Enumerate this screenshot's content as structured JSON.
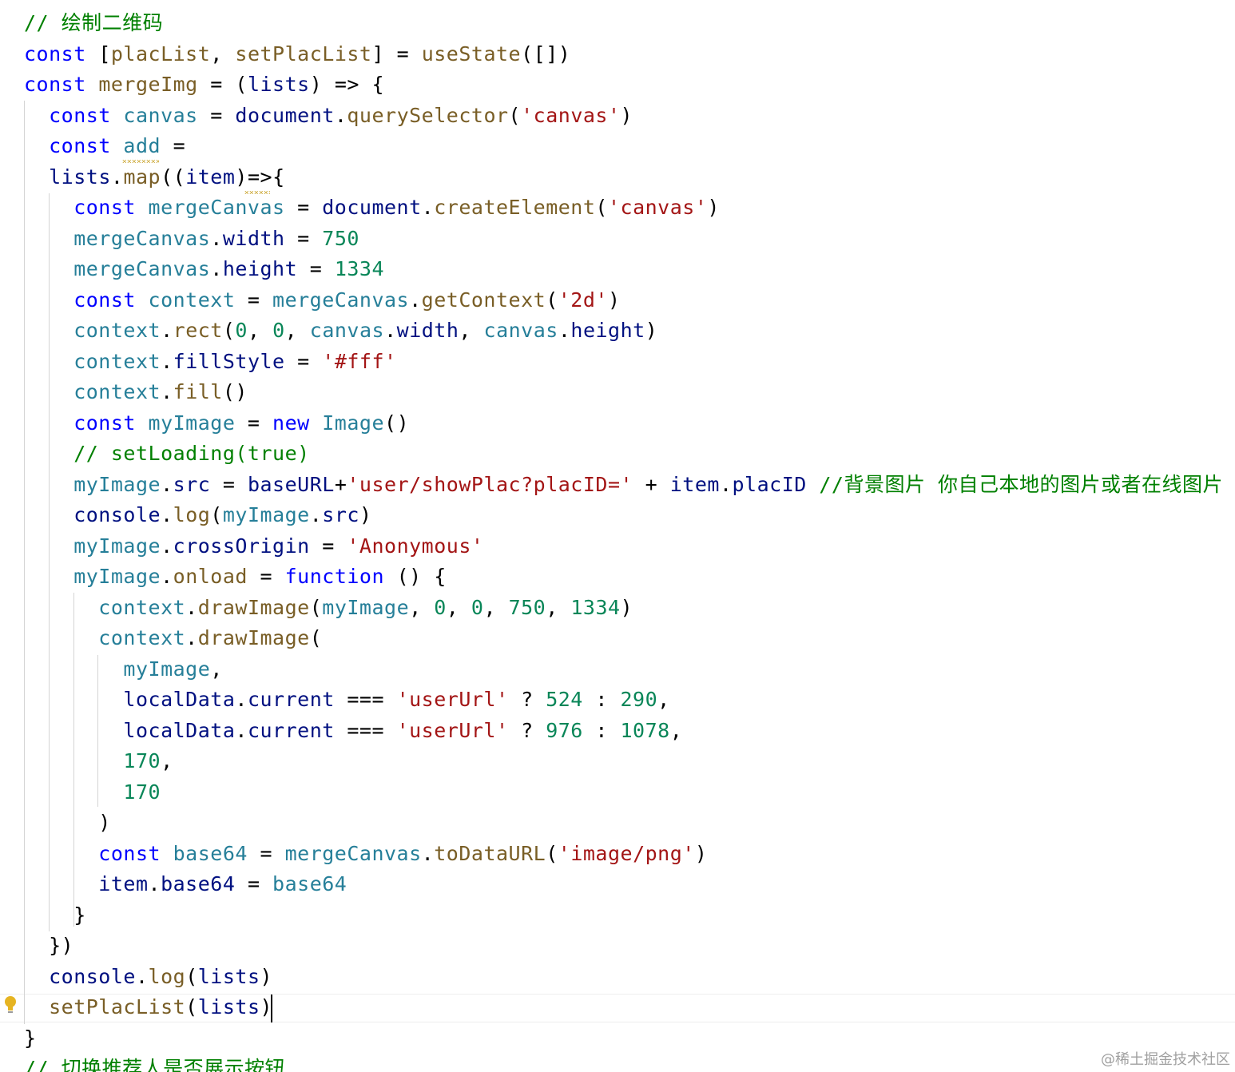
{
  "editor": {
    "colors": {
      "keyword": "#0000ff",
      "variable": "#267f99",
      "function": "#795e26",
      "string": "#a31515",
      "number": "#098658",
      "comment": "#008000",
      "plain": "#001080",
      "text": "#000000"
    },
    "lines": [
      [
        {
          "t": "// 绘制二维码",
          "c": "comment"
        }
      ],
      [
        {
          "t": "const ",
          "c": "keyword"
        },
        {
          "t": "[",
          "c": "text"
        },
        {
          "t": "placList",
          "c": "function"
        },
        {
          "t": ", ",
          "c": "text"
        },
        {
          "t": "setPlacList",
          "c": "function"
        },
        {
          "t": "] = ",
          "c": "text"
        },
        {
          "t": "useState",
          "c": "function"
        },
        {
          "t": "([])",
          "c": "text"
        }
      ],
      [
        {
          "t": "const ",
          "c": "keyword"
        },
        {
          "t": "mergeImg",
          "c": "function"
        },
        {
          "t": " = (",
          "c": "text"
        },
        {
          "t": "lists",
          "c": "plain"
        },
        {
          "t": ") => {",
          "c": "text"
        }
      ],
      [
        {
          "t": "  const ",
          "c": "keyword"
        },
        {
          "t": "canvas",
          "c": "variable"
        },
        {
          "t": " = ",
          "c": "text"
        },
        {
          "t": "document",
          "c": "plain"
        },
        {
          "t": ".",
          "c": "text"
        },
        {
          "t": "querySelector",
          "c": "function"
        },
        {
          "t": "(",
          "c": "text"
        },
        {
          "t": "'canvas'",
          "c": "string"
        },
        {
          "t": ")",
          "c": "text"
        }
      ],
      [
        {
          "t": "  const ",
          "c": "keyword"
        },
        {
          "t": "add",
          "c": "variable"
        },
        {
          "t": " =",
          "c": "text"
        }
      ],
      [
        {
          "t": "  ",
          "c": "text"
        },
        {
          "t": "lists",
          "c": "plain"
        },
        {
          "t": ".",
          "c": "text"
        },
        {
          "t": "map",
          "c": "function"
        },
        {
          "t": "((",
          "c": "text"
        },
        {
          "t": "item",
          "c": "plain"
        },
        {
          "t": ")=>{",
          "c": "text"
        }
      ],
      [
        {
          "t": "    const ",
          "c": "keyword"
        },
        {
          "t": "mergeCanvas",
          "c": "variable"
        },
        {
          "t": " = ",
          "c": "text"
        },
        {
          "t": "document",
          "c": "plain"
        },
        {
          "t": ".",
          "c": "text"
        },
        {
          "t": "createElement",
          "c": "function"
        },
        {
          "t": "(",
          "c": "text"
        },
        {
          "t": "'canvas'",
          "c": "string"
        },
        {
          "t": ")",
          "c": "text"
        }
      ],
      [
        {
          "t": "    mergeCanvas",
          "c": "variable"
        },
        {
          "t": ".",
          "c": "text"
        },
        {
          "t": "width",
          "c": "plain"
        },
        {
          "t": " = ",
          "c": "text"
        },
        {
          "t": "750",
          "c": "number"
        }
      ],
      [
        {
          "t": "    mergeCanvas",
          "c": "variable"
        },
        {
          "t": ".",
          "c": "text"
        },
        {
          "t": "height",
          "c": "plain"
        },
        {
          "t": " = ",
          "c": "text"
        },
        {
          "t": "1334",
          "c": "number"
        }
      ],
      [
        {
          "t": "    const ",
          "c": "keyword"
        },
        {
          "t": "context",
          "c": "variable"
        },
        {
          "t": " = ",
          "c": "text"
        },
        {
          "t": "mergeCanvas",
          "c": "variable"
        },
        {
          "t": ".",
          "c": "text"
        },
        {
          "t": "getContext",
          "c": "function"
        },
        {
          "t": "(",
          "c": "text"
        },
        {
          "t": "'2d'",
          "c": "string"
        },
        {
          "t": ")",
          "c": "text"
        }
      ],
      [
        {
          "t": "    context",
          "c": "variable"
        },
        {
          "t": ".",
          "c": "text"
        },
        {
          "t": "rect",
          "c": "function"
        },
        {
          "t": "(",
          "c": "text"
        },
        {
          "t": "0",
          "c": "number"
        },
        {
          "t": ", ",
          "c": "text"
        },
        {
          "t": "0",
          "c": "number"
        },
        {
          "t": ", ",
          "c": "text"
        },
        {
          "t": "canvas",
          "c": "variable"
        },
        {
          "t": ".",
          "c": "text"
        },
        {
          "t": "width",
          "c": "plain"
        },
        {
          "t": ", ",
          "c": "text"
        },
        {
          "t": "canvas",
          "c": "variable"
        },
        {
          "t": ".",
          "c": "text"
        },
        {
          "t": "height",
          "c": "plain"
        },
        {
          "t": ")",
          "c": "text"
        }
      ],
      [
        {
          "t": "    context",
          "c": "variable"
        },
        {
          "t": ".",
          "c": "text"
        },
        {
          "t": "fillStyle",
          "c": "plain"
        },
        {
          "t": " = ",
          "c": "text"
        },
        {
          "t": "'#fff'",
          "c": "string"
        }
      ],
      [
        {
          "t": "    context",
          "c": "variable"
        },
        {
          "t": ".",
          "c": "text"
        },
        {
          "t": "fill",
          "c": "function"
        },
        {
          "t": "()",
          "c": "text"
        }
      ],
      [
        {
          "t": "    const ",
          "c": "keyword"
        },
        {
          "t": "myImage",
          "c": "variable"
        },
        {
          "t": " = ",
          "c": "text"
        },
        {
          "t": "new ",
          "c": "keyword"
        },
        {
          "t": "Image",
          "c": "variable"
        },
        {
          "t": "()",
          "c": "text"
        }
      ],
      [
        {
          "t": "    // setLoading(true)",
          "c": "comment"
        }
      ],
      [
        {
          "t": "    myImage",
          "c": "variable"
        },
        {
          "t": ".",
          "c": "text"
        },
        {
          "t": "src",
          "c": "plain"
        },
        {
          "t": " = ",
          "c": "text"
        },
        {
          "t": "baseURL",
          "c": "plain"
        },
        {
          "t": "+",
          "c": "text"
        },
        {
          "t": "'user/showPlac?placID='",
          "c": "string"
        },
        {
          "t": " + ",
          "c": "text"
        },
        {
          "t": "item",
          "c": "plain"
        },
        {
          "t": ".",
          "c": "text"
        },
        {
          "t": "placID",
          "c": "plain"
        },
        {
          "t": " //背景图片 你自己本地的图片或者在线图片",
          "c": "comment"
        }
      ],
      [
        {
          "t": "    console",
          "c": "plain"
        },
        {
          "t": ".",
          "c": "text"
        },
        {
          "t": "log",
          "c": "function"
        },
        {
          "t": "(",
          "c": "text"
        },
        {
          "t": "myImage",
          "c": "variable"
        },
        {
          "t": ".",
          "c": "text"
        },
        {
          "t": "src",
          "c": "plain"
        },
        {
          "t": ")",
          "c": "text"
        }
      ],
      [
        {
          "t": "    myImage",
          "c": "variable"
        },
        {
          "t": ".",
          "c": "text"
        },
        {
          "t": "crossOrigin",
          "c": "plain"
        },
        {
          "t": " = ",
          "c": "text"
        },
        {
          "t": "'Anonymous'",
          "c": "string"
        }
      ],
      [
        {
          "t": "    myImage",
          "c": "variable"
        },
        {
          "t": ".",
          "c": "text"
        },
        {
          "t": "onload",
          "c": "function"
        },
        {
          "t": " = ",
          "c": "text"
        },
        {
          "t": "function",
          "c": "keyword"
        },
        {
          "t": " () {",
          "c": "text"
        }
      ],
      [
        {
          "t": "      context",
          "c": "variable"
        },
        {
          "t": ".",
          "c": "text"
        },
        {
          "t": "drawImage",
          "c": "function"
        },
        {
          "t": "(",
          "c": "text"
        },
        {
          "t": "myImage",
          "c": "variable"
        },
        {
          "t": ", ",
          "c": "text"
        },
        {
          "t": "0",
          "c": "number"
        },
        {
          "t": ", ",
          "c": "text"
        },
        {
          "t": "0",
          "c": "number"
        },
        {
          "t": ", ",
          "c": "text"
        },
        {
          "t": "750",
          "c": "number"
        },
        {
          "t": ", ",
          "c": "text"
        },
        {
          "t": "1334",
          "c": "number"
        },
        {
          "t": ")",
          "c": "text"
        }
      ],
      [
        {
          "t": "      context",
          "c": "variable"
        },
        {
          "t": ".",
          "c": "text"
        },
        {
          "t": "drawImage",
          "c": "function"
        },
        {
          "t": "(",
          "c": "text"
        }
      ],
      [
        {
          "t": "        myImage",
          "c": "variable"
        },
        {
          "t": ",",
          "c": "text"
        }
      ],
      [
        {
          "t": "        localData",
          "c": "plain"
        },
        {
          "t": ".",
          "c": "text"
        },
        {
          "t": "current",
          "c": "plain"
        },
        {
          "t": " === ",
          "c": "text"
        },
        {
          "t": "'userUrl'",
          "c": "string"
        },
        {
          "t": " ? ",
          "c": "text"
        },
        {
          "t": "524",
          "c": "number"
        },
        {
          "t": " : ",
          "c": "text"
        },
        {
          "t": "290",
          "c": "number"
        },
        {
          "t": ",",
          "c": "text"
        }
      ],
      [
        {
          "t": "        localData",
          "c": "plain"
        },
        {
          "t": ".",
          "c": "text"
        },
        {
          "t": "current",
          "c": "plain"
        },
        {
          "t": " === ",
          "c": "text"
        },
        {
          "t": "'userUrl'",
          "c": "string"
        },
        {
          "t": " ? ",
          "c": "text"
        },
        {
          "t": "976",
          "c": "number"
        },
        {
          "t": " : ",
          "c": "text"
        },
        {
          "t": "1078",
          "c": "number"
        },
        {
          "t": ",",
          "c": "text"
        }
      ],
      [
        {
          "t": "        170",
          "c": "number"
        },
        {
          "t": ",",
          "c": "text"
        }
      ],
      [
        {
          "t": "        170",
          "c": "number"
        }
      ],
      [
        {
          "t": "      )",
          "c": "text"
        }
      ],
      [
        {
          "t": "      const ",
          "c": "keyword"
        },
        {
          "t": "base64",
          "c": "variable"
        },
        {
          "t": " = ",
          "c": "text"
        },
        {
          "t": "mergeCanvas",
          "c": "variable"
        },
        {
          "t": ".",
          "c": "text"
        },
        {
          "t": "toDataURL",
          "c": "function"
        },
        {
          "t": "(",
          "c": "text"
        },
        {
          "t": "'image/png'",
          "c": "string"
        },
        {
          "t": ")",
          "c": "text"
        }
      ],
      [
        {
          "t": "      item",
          "c": "plain"
        },
        {
          "t": ".",
          "c": "text"
        },
        {
          "t": "base64",
          "c": "plain"
        },
        {
          "t": " = ",
          "c": "text"
        },
        {
          "t": "base64",
          "c": "variable"
        }
      ],
      [
        {
          "t": "    }",
          "c": "text"
        }
      ],
      [
        {
          "t": "  })",
          "c": "text"
        }
      ],
      [
        {
          "t": "  console",
          "c": "plain"
        },
        {
          "t": ".",
          "c": "text"
        },
        {
          "t": "log",
          "c": "function"
        },
        {
          "t": "(",
          "c": "text"
        },
        {
          "t": "lists",
          "c": "plain"
        },
        {
          "t": ")",
          "c": "text"
        }
      ],
      [
        {
          "t": "  setPlacList",
          "c": "function"
        },
        {
          "t": "(",
          "c": "text"
        },
        {
          "t": "lists",
          "c": "plain"
        },
        {
          "t": ")",
          "c": "text"
        }
      ],
      [
        {
          "t": "}",
          "c": "text"
        }
      ],
      [
        {
          "t": "// 切换推荐人是否展示按钮",
          "c": "comment"
        }
      ]
    ]
  },
  "watermark": "@稀土掘金技术社区"
}
